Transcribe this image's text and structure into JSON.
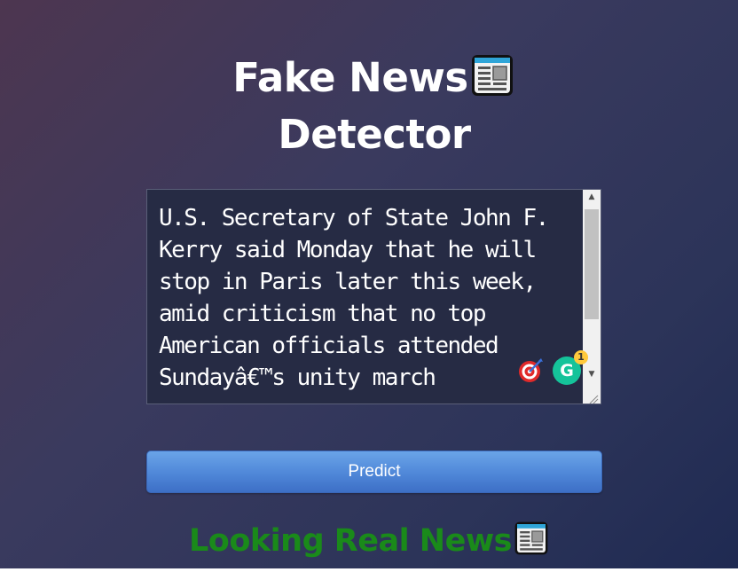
{
  "app": {
    "title_line1": "Fake News",
    "title_line2": "Detector",
    "title_icon": "newspaper-icon"
  },
  "input": {
    "text": "U.S. Secretary of State John F. Kerry said Monday that he will stop in Paris later this week, amid criticism that no top American officials attended Sundayâ€™s unity march"
  },
  "extensions": {
    "target_icon": "target-icon",
    "grammarly_letter": "G",
    "grammarly_count": "1"
  },
  "predict": {
    "label": "Predict"
  },
  "result": {
    "text": "Looking Real News",
    "icon": "newspaper-icon",
    "color": "#1a8a1a"
  },
  "colors": {
    "button": "#4f87d8",
    "textbox_bg": "#262b44",
    "grammarly": "#15c39a"
  }
}
